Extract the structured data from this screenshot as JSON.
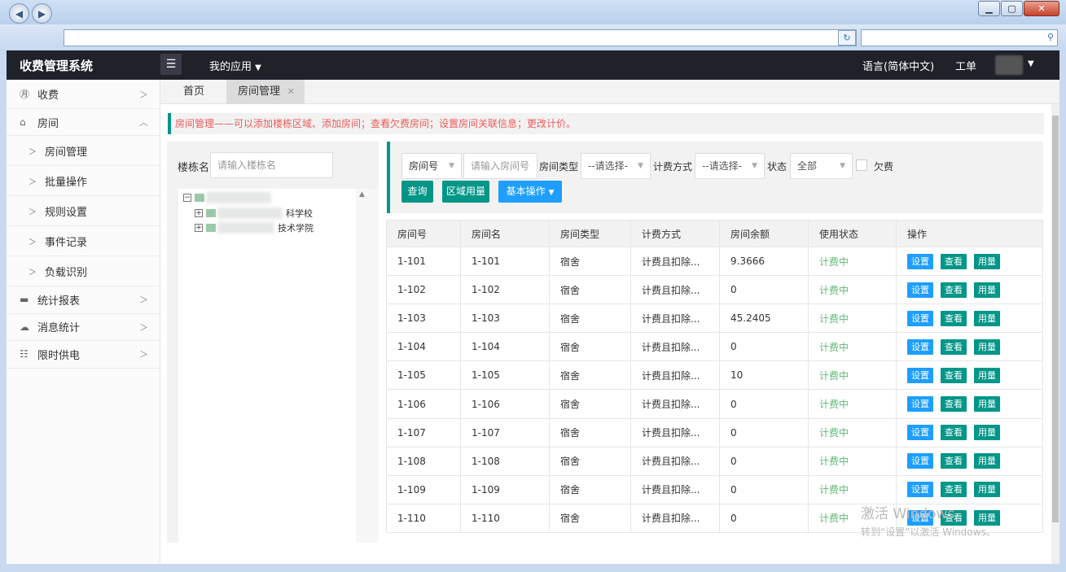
{
  "app": {
    "brand": "收费管理系统",
    "my_apps": "我的应用",
    "language": "语言(简体中文)",
    "ticket": "工单"
  },
  "sidebar": {
    "items": [
      {
        "label": "收费",
        "icon": "yen-icon"
      },
      {
        "label": "房间",
        "icon": "home-icon"
      },
      {
        "label": "统计报表",
        "icon": "monitor-icon"
      },
      {
        "label": "消息统计",
        "icon": "chat-icon"
      },
      {
        "label": "限时供电",
        "icon": "sliders-icon"
      }
    ],
    "sub_items": [
      "房间管理",
      "批量操作",
      "规则设置",
      "事件记录",
      "负载识别"
    ]
  },
  "tabs": {
    "home": "首页",
    "active": "房间管理"
  },
  "notice": "房间管理——可以添加楼栋区域、添加房间；查看欠费房间；设置房间关联信息；更改计价。",
  "building": {
    "label": "楼栋名",
    "placeholder": "请输入楼栋名",
    "tree": [
      "科学校",
      "技术学院"
    ]
  },
  "filter": {
    "room_field": "房间号",
    "room_placeholder": "请输入房间号",
    "type_label": "房间类型",
    "type_value": "--请选择-",
    "billing_label": "计费方式",
    "billing_value": "--请选择-",
    "status_label": "状态",
    "status_value": "全部",
    "arrears_label": "欠费",
    "query_btn": "查询",
    "area_btn": "区域用量",
    "basic_btn": "基本操作"
  },
  "table": {
    "headers": [
      "房间号",
      "房间名",
      "房间类型",
      "计费方式",
      "房间余额",
      "使用状态",
      "操作"
    ],
    "actions": {
      "set": "设置",
      "view": "查看",
      "usage": "用量"
    },
    "rows": [
      {
        "no": "1-101",
        "name": "1-101",
        "type": "宿舍",
        "billing": "计费且扣除...",
        "balance": "9.3666",
        "status": "计费中"
      },
      {
        "no": "1-102",
        "name": "1-102",
        "type": "宿舍",
        "billing": "计费且扣除...",
        "balance": "0",
        "status": "计费中"
      },
      {
        "no": "1-103",
        "name": "1-103",
        "type": "宿舍",
        "billing": "计费且扣除...",
        "balance": "45.2405",
        "status": "计费中"
      },
      {
        "no": "1-104",
        "name": "1-104",
        "type": "宿舍",
        "billing": "计费且扣除...",
        "balance": "0",
        "status": "计费中"
      },
      {
        "no": "1-105",
        "name": "1-105",
        "type": "宿舍",
        "billing": "计费且扣除...",
        "balance": "10",
        "status": "计费中"
      },
      {
        "no": "1-106",
        "name": "1-106",
        "type": "宿舍",
        "billing": "计费且扣除...",
        "balance": "0",
        "status": "计费中"
      },
      {
        "no": "1-107",
        "name": "1-107",
        "type": "宿舍",
        "billing": "计费且扣除...",
        "balance": "0",
        "status": "计费中"
      },
      {
        "no": "1-108",
        "name": "1-108",
        "type": "宿舍",
        "billing": "计费且扣除...",
        "balance": "0",
        "status": "计费中"
      },
      {
        "no": "1-109",
        "name": "1-109",
        "type": "宿舍",
        "billing": "计费且扣除...",
        "balance": "0",
        "status": "计费中"
      },
      {
        "no": "1-110",
        "name": "1-110",
        "type": "宿舍",
        "billing": "计费且扣除...",
        "balance": "0",
        "status": "计费中"
      }
    ]
  },
  "watermark": {
    "line1": "激活 Windows",
    "line2": "转到“设置”以激活 Windows。"
  },
  "colors": {
    "accent": "#009688",
    "blue": "#1e9fff",
    "status_green": "#5fb878",
    "notice_red": "#ef5b5b"
  }
}
